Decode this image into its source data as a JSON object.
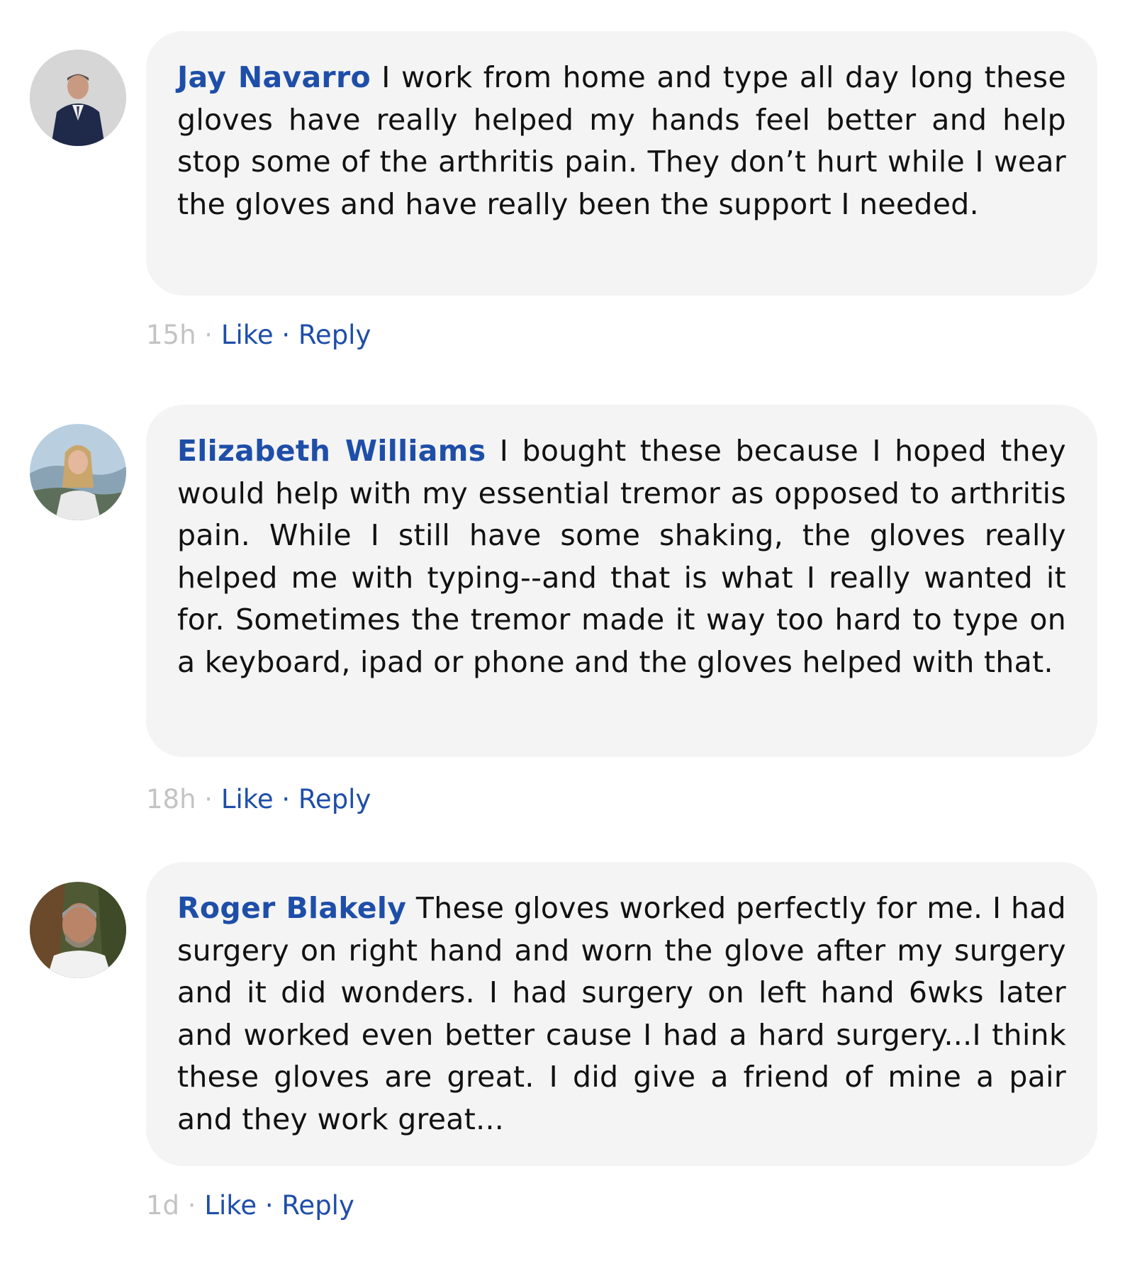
{
  "colors": {
    "name_blue": "#1e4ea8",
    "bubble_bg": "#f4f4f4",
    "time_grey": "#c3c3c3"
  },
  "comments": [
    {
      "author": "Jay Navarro",
      "text": "I work from home and type all day long these gloves have really helped my hands feel better and help stop some of the arthritis pain. They don’t hurt while I wear the gloves and have really been the support I needed.",
      "time": "15h",
      "like_label": "Like",
      "reply_label": "Reply",
      "separator": "·",
      "avatar_icon": "man-in-suit-avatar"
    },
    {
      "author": "Elizabeth Williams",
      "text": "I bought these because I hoped they would help with my essential tremor as opposed to arthritis pain. While I still have some shaking, the gloves really helped me with typing--and that is what I really wanted it for. Sometimes the tremor made it way too hard to type on a keyboard, ipad or phone and the gloves helped with that.",
      "time": "18h",
      "like_label": "Like",
      "reply_label": "Reply",
      "separator": "·",
      "avatar_icon": "woman-outdoors-avatar"
    },
    {
      "author": "Roger Blakely",
      "text": "These gloves worked perfectly for me. I had surgery on right hand and worn the glove after my surgery and it did wonders. I had surgery on left hand 6wks later and worked even better cause I had a hard surgery...I think these gloves are great. I did give a friend of mine a pair and they work great...",
      "time": "1d",
      "like_label": "Like",
      "reply_label": "Reply",
      "separator": "·",
      "avatar_icon": "bearded-man-avatar"
    }
  ]
}
